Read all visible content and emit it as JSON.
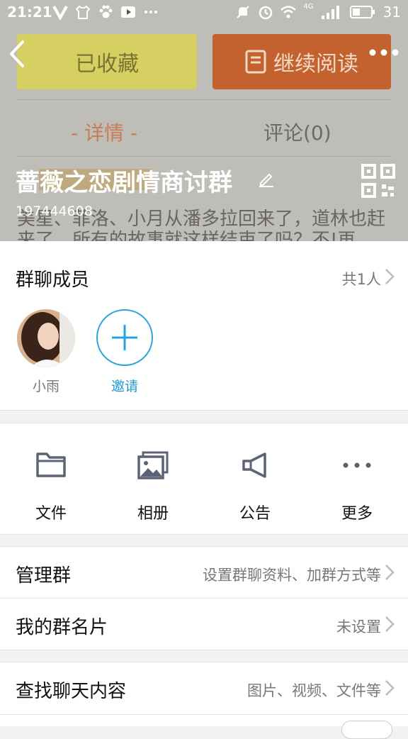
{
  "status_bar": {
    "time": "21:21",
    "network": "4G",
    "battery": "31"
  },
  "background": {
    "collected_label": "已收藏",
    "continue_label": "继续阅读",
    "tab_detail": "- 详情 -",
    "tab_comments": "评论(0)",
    "description": "美星、菲洛、小月从潘多拉回来了，道林也赶来了，所有的故事就这样结束了吗？不!再"
  },
  "header": {
    "group_name": "蔷薇之恋剧情商讨群",
    "group_id": "197444608"
  },
  "members": {
    "title": "群聊成员",
    "count": "共1人",
    "list": [
      {
        "name": "小雨"
      }
    ],
    "invite_label": "邀请"
  },
  "tools": [
    {
      "label": "文件",
      "icon": "folder-icon"
    },
    {
      "label": "相册",
      "icon": "album-icon"
    },
    {
      "label": "公告",
      "icon": "megaphone-icon"
    },
    {
      "label": "更多",
      "icon": "more-icon"
    }
  ],
  "settings": {
    "manage_title": "管理群",
    "manage_value": "设置群聊资料、加群方式等",
    "card_title": "我的群名片",
    "card_value": "未设置",
    "search_title": "查找聊天内容",
    "search_value": "图片、视频、文件等"
  },
  "colors": {
    "accent": "#2aa3dc",
    "invite_text": "#239ad6"
  }
}
